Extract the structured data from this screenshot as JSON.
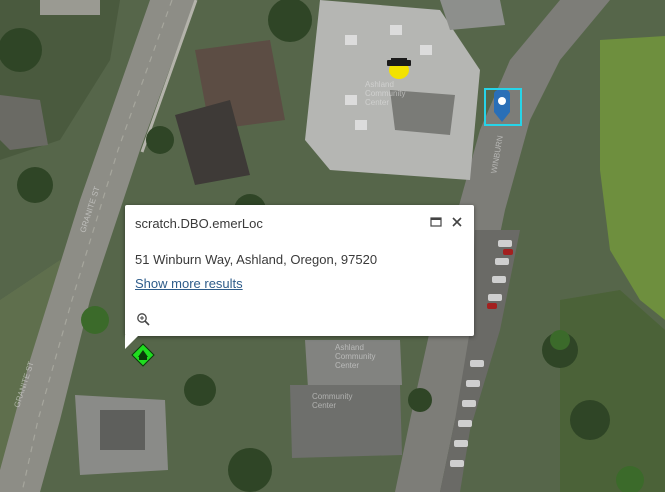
{
  "popup": {
    "title": "scratch.DBO.emerLoc",
    "address": "51 Winburn Way, Ashland, Oregon, 97520",
    "more_link": "Show more results"
  },
  "map_labels": {
    "granite_st_north": "GRANITE ST",
    "granite_st_south": "GRANITE ST",
    "winburn": "WINBURN",
    "ashland_community_center_1": "Ashland Community Center",
    "ashland_community_center_2": "Ashland Community Center",
    "community_center": "Community Center"
  },
  "icons": {
    "maximize": "maximize-icon",
    "close": "close-icon",
    "zoom": "zoom-in-icon",
    "pin": "map-pin-icon",
    "emergency": "emergency-location-icon",
    "vehicle": "vehicle-icon"
  },
  "colors": {
    "selection": "#27d4e8",
    "pin": "#2a6fb7",
    "emergency": "#1fdc1f",
    "vehicle": "#f2e200",
    "link": "#2e5c8a"
  }
}
